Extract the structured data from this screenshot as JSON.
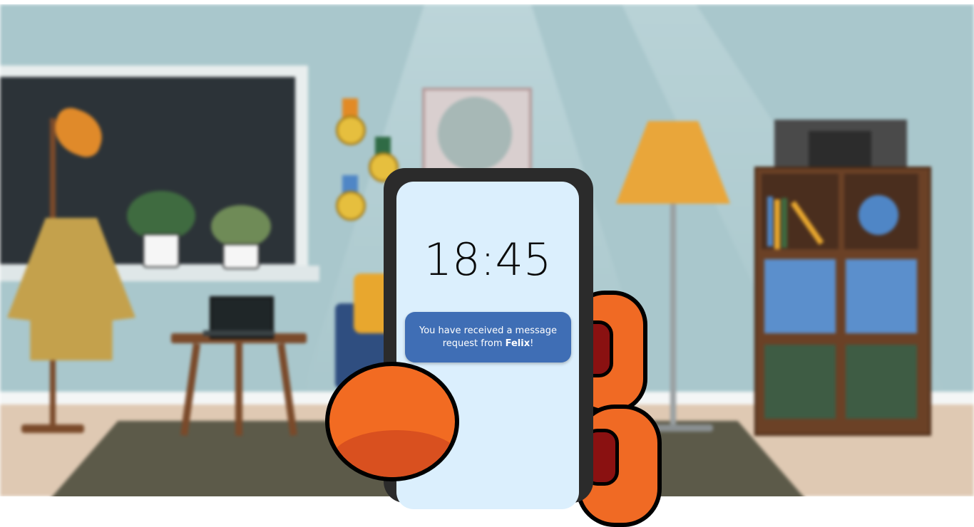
{
  "phone": {
    "time": "18:45",
    "notification": {
      "prefix": "You have received a message request from ",
      "sender": "Felix",
      "suffix": "!"
    }
  },
  "colors": {
    "wall": "#a9c7cc",
    "floor": "#dfc9b3",
    "hand": "#f26b22",
    "notification_bg": "#3f6eb5",
    "screen_bg": "#dbeffd"
  },
  "icons": {
    "background": "blurred-living-room-illustration",
    "hand": "cartoon-hand-holding-phone"
  }
}
